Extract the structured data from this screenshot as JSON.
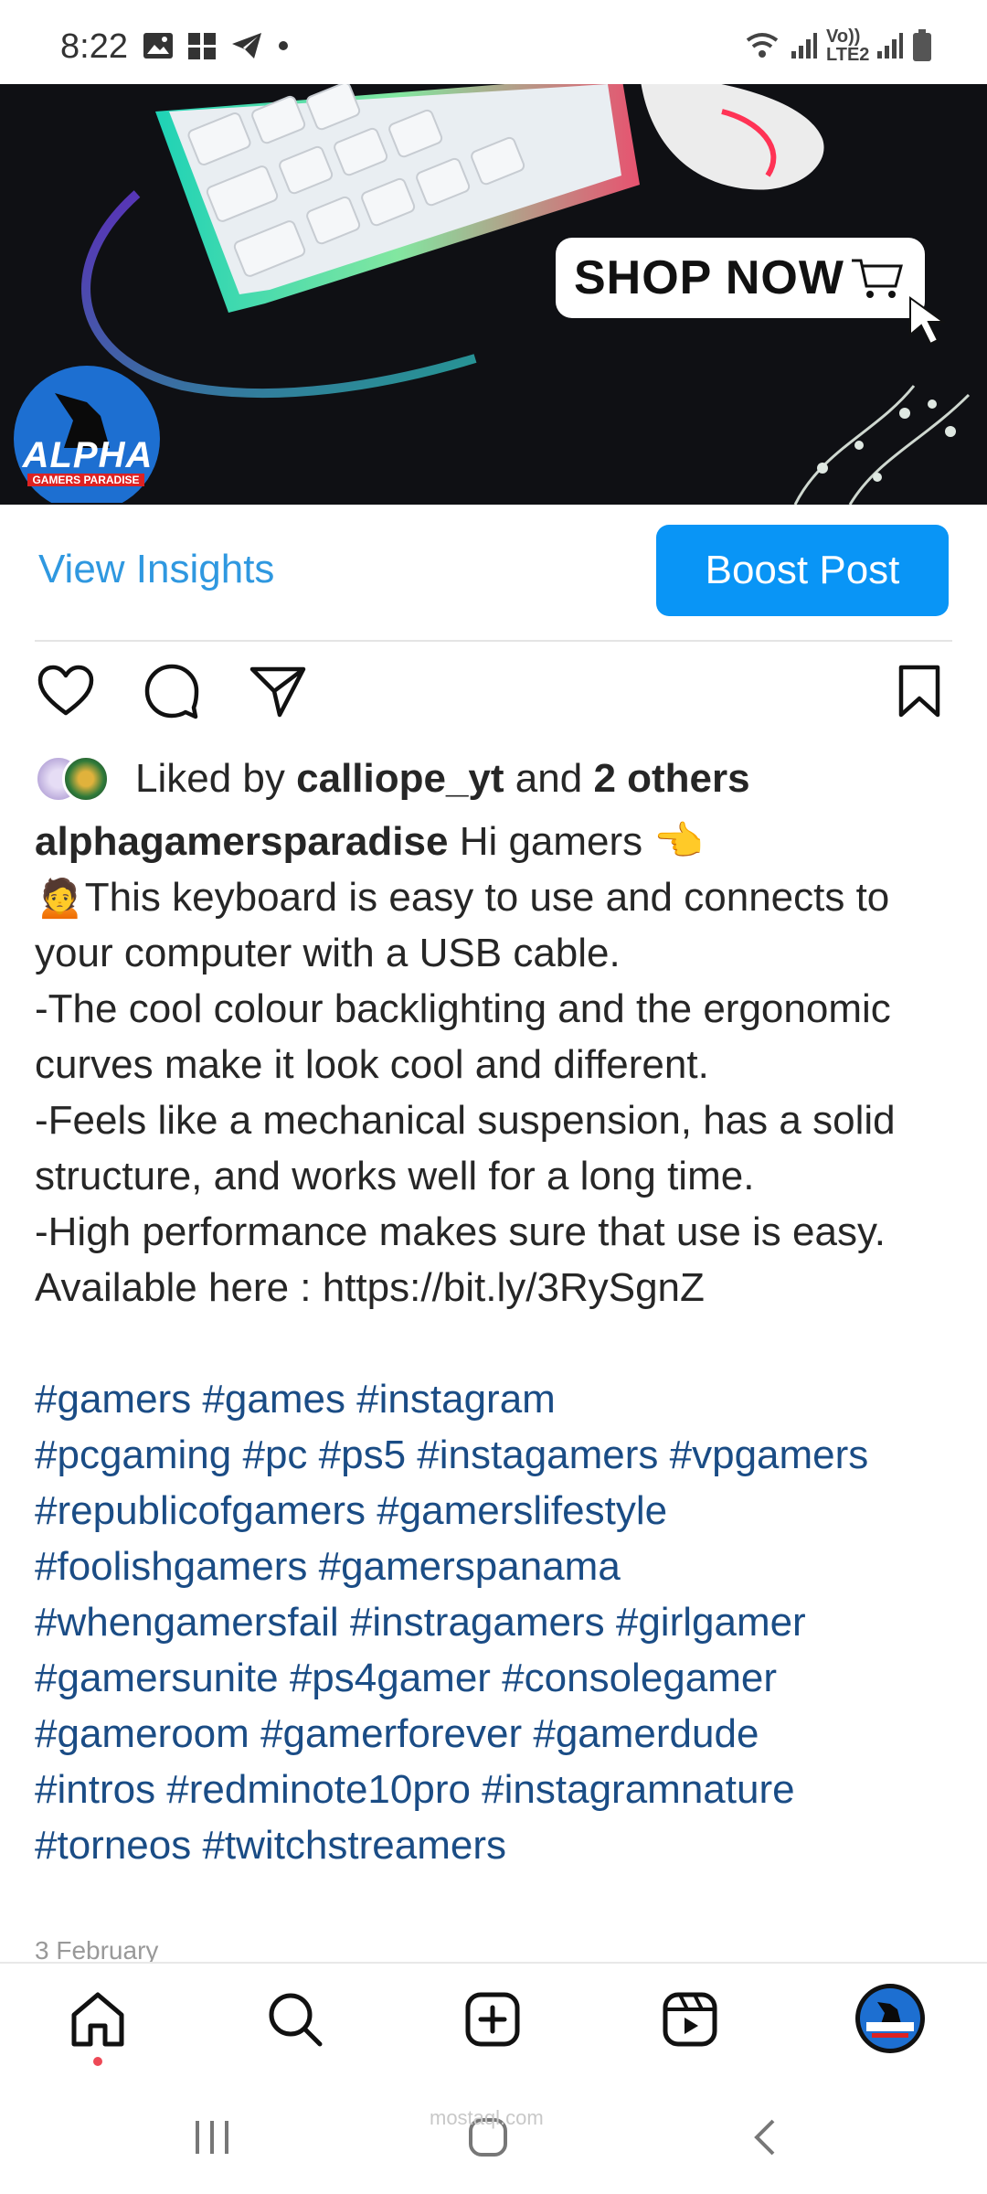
{
  "status_bar": {
    "time": "8:22",
    "right_label": "Vo)) LTE2",
    "icons": [
      "gallery-icon",
      "grid-icon",
      "telegram-icon",
      "dot-icon",
      "wifi-icon",
      "signal-icon",
      "signal-icon",
      "battery-icon"
    ]
  },
  "post_image": {
    "shop_label": "SHOP NOW",
    "brand_name": "ALPHA",
    "brand_tagline": "GAMERS PARADISE"
  },
  "insights": {
    "view_insights_label": "View Insights",
    "boost_label": "Boost Post",
    "accent": "#0995f6"
  },
  "actions": {
    "icons": [
      "heart-icon",
      "comment-icon",
      "share-icon",
      "bookmark-icon"
    ]
  },
  "likes": {
    "prefix": "Liked by",
    "user": "calliope_yt",
    "middle": "and",
    "others": "2 others"
  },
  "caption": {
    "username": "alphagamersparadise",
    "first_line": "Hi gamers 👈",
    "lines": [
      "🙍This keyboard is easy to use and connects to your computer with a USB cable.",
      "-The cool colour backlighting and the ergonomic curves make it look cool and different.",
      "-Feels like a mechanical suspension, has a solid structure, and works well for a long time.",
      "-High performance makes sure that use is easy.",
      "Available here : https://bit.ly/3RySgnZ"
    ],
    "hashtag_lines": [
      "#gamers #games #instagram",
      "#pcgaming #pc #ps5 #instagamers #vpgamers",
      "#republicofgamers #gamerslifestyle",
      "#foolishgamers #gamerspanama",
      "#whengamersfail #instragamers #girlgamer",
      "#gamersunite #ps4gamer #consolegamer",
      "#gameroom #gamerforever #gamerdude",
      "#intros #redminote10pro #instagramnature",
      "#torneos #twitchstreamers"
    ],
    "hashtag_color": "#1a4c85"
  },
  "date": "3 February",
  "bottom_nav": {
    "items": [
      "home-icon",
      "search-icon",
      "create-icon",
      "reels-icon",
      "profile-avatar"
    ],
    "active": "home-icon"
  },
  "watermark": "mostaql.com"
}
